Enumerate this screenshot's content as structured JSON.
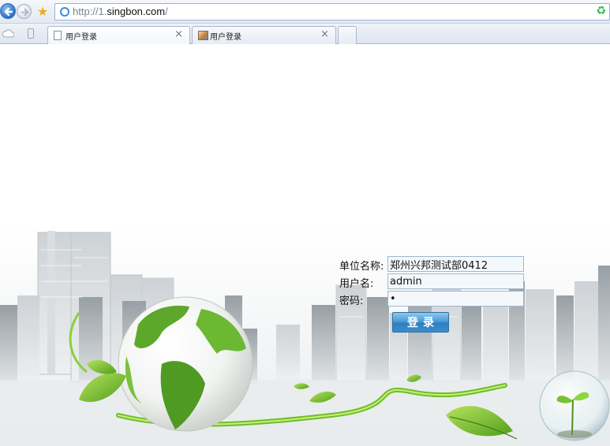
{
  "browser": {
    "address": {
      "scheme": "http://1.",
      "host": "singbon.com",
      "path": "/"
    },
    "tabs": [
      {
        "label": "用户登录",
        "active": true,
        "icon": "document-icon"
      },
      {
        "label": "用户登录",
        "active": false,
        "icon": "image-icon"
      }
    ],
    "close_glyph": "×"
  },
  "login": {
    "unit_label": "单位名称:",
    "unit_value": "郑州兴邦测试部0412",
    "user_label": "用户名:",
    "user_value": "admin",
    "password_label": "密码:",
    "password_value": "•",
    "submit_label": "登录"
  },
  "colors": {
    "accent_green": "#6fbd2b",
    "button_blue": "#3d8ccc"
  }
}
